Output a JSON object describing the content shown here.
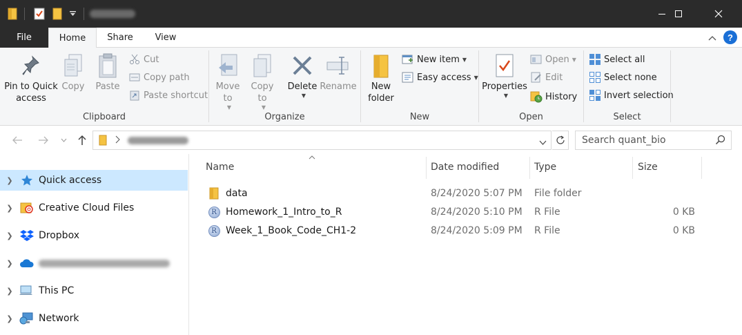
{
  "window": {
    "minimize_glyph": "—",
    "maximize_glyph": "☐",
    "close_glyph": "✕"
  },
  "tabs": {
    "file": "File",
    "home": "Home",
    "share": "Share",
    "view": "View"
  },
  "ribbon": {
    "clipboard": {
      "label": "Clipboard",
      "pin": "Pin to Quick access",
      "copy": "Copy",
      "paste": "Paste",
      "cut": "Cut",
      "copy_path": "Copy path",
      "paste_shortcut": "Paste shortcut"
    },
    "organize": {
      "label": "Organize",
      "move_to": "Move to",
      "copy_to": "Copy to",
      "delete": "Delete",
      "rename": "Rename"
    },
    "new": {
      "label": "New",
      "new_folder": "New folder",
      "new_item": "New item",
      "easy_access": "Easy access"
    },
    "open": {
      "label": "Open",
      "properties": "Properties",
      "open": "Open",
      "edit": "Edit",
      "history": "History"
    },
    "select": {
      "label": "Select",
      "select_all": "Select all",
      "select_none": "Select none",
      "invert_selection": "Invert selection"
    }
  },
  "address": {
    "search_placeholder": "Search quant_bio"
  },
  "nav_pane": {
    "items": [
      {
        "label": "Quick access",
        "icon": "star-icon"
      },
      {
        "label": "Creative Cloud Files",
        "icon": "creative-cloud-icon"
      },
      {
        "label": "Dropbox",
        "icon": "dropbox-icon"
      },
      {
        "label": "",
        "icon": "onedrive-icon"
      },
      {
        "label": "This PC",
        "icon": "computer-icon"
      },
      {
        "label": "Network",
        "icon": "network-icon"
      }
    ]
  },
  "file_list": {
    "columns": [
      "Name",
      "Date modified",
      "Type",
      "Size"
    ],
    "rows": [
      {
        "name": "data",
        "date": "8/24/2020 5:07 PM",
        "type": "File folder",
        "size": "",
        "icon": "folder-icon"
      },
      {
        "name": "Homework_1_Intro_to_R",
        "date": "8/24/2020 5:10 PM",
        "type": "R File",
        "size": "0 KB",
        "icon": "r-file-icon"
      },
      {
        "name": "Week_1_Book_Code_CH1-2",
        "date": "8/24/2020 5:09 PM",
        "type": "R File",
        "size": "0 KB",
        "icon": "r-file-icon"
      }
    ]
  },
  "colors": {
    "titlebar": "#2b2b2b",
    "ribbon_bg": "#f5f6f7",
    "selected_nav": "#cce8ff",
    "folder_yellow": "#f5c342",
    "help_blue": "#1a6fd6"
  }
}
